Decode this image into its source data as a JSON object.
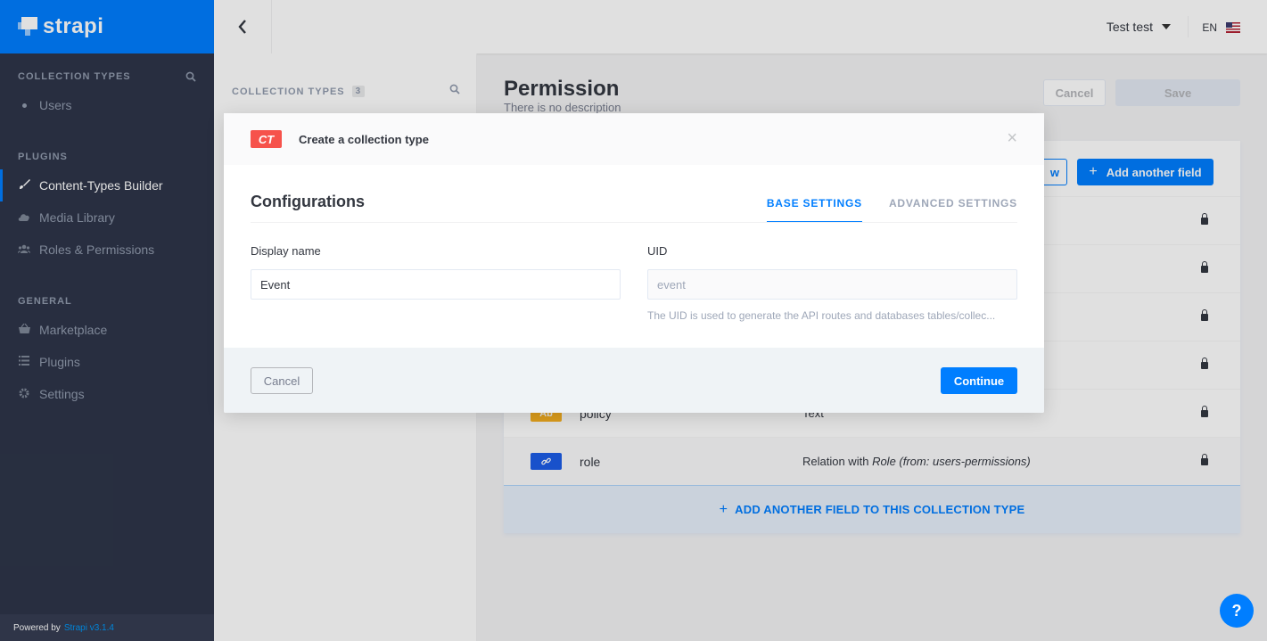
{
  "brand": {
    "name": "strapi"
  },
  "leftnav": {
    "sections": [
      {
        "title": "COLLECTION TYPES",
        "items": [
          {
            "label": "Users"
          }
        ]
      },
      {
        "title": "PLUGINS",
        "items": [
          {
            "label": "Content-Types Builder",
            "icon": "brush-icon"
          },
          {
            "label": "Media Library",
            "icon": "cloud-icon"
          },
          {
            "label": "Roles & Permissions",
            "icon": "users-icon"
          }
        ]
      },
      {
        "title": "GENERAL",
        "items": [
          {
            "label": "Marketplace",
            "icon": "shopping-basket-icon"
          },
          {
            "label": "Plugins",
            "icon": "list-icon"
          },
          {
            "label": "Settings",
            "icon": "gear-icon"
          }
        ]
      }
    ],
    "powered_by": "Powered by",
    "version_link": "Strapi v3.1.4"
  },
  "header": {
    "user": "Test test",
    "lang": "EN"
  },
  "ct_panel": {
    "title": "COLLECTION TYPES",
    "count": "3"
  },
  "main": {
    "title": "Permission",
    "description": "There is no description",
    "cancel_label": "Cancel",
    "save_label": "Save",
    "edit_label": "w",
    "add_field_label": "Add another field",
    "rows": [
      {
        "name": "policy",
        "type": "Text",
        "badge": "Ab",
        "badge_color": "#fab220"
      },
      {
        "name": "role",
        "type_prefix": "Relation with",
        "type_italic": "Role (from: users-permissions)",
        "badge_color": "#1c5de7"
      }
    ],
    "add_footer_label": "ADD ANOTHER FIELD TO THIS COLLECTION TYPE"
  },
  "modal": {
    "badge": "CT",
    "header_title": "Create a collection type",
    "subtitle": "Configurations",
    "tabs": [
      {
        "label": "BASE SETTINGS"
      },
      {
        "label": "ADVANCED SETTINGS"
      }
    ],
    "display_name_label": "Display name",
    "display_name_value": "Event",
    "uid_label": "UID",
    "uid_value": "event",
    "uid_hint": "The UID is used to generate the API routes and databases tables/collec...",
    "cancel_label": "Cancel",
    "continue_label": "Continue"
  },
  "help_label": "?",
  "colors": {
    "accent": "#007eff",
    "nav_bg": "#2e3549",
    "ct_badge": "#f6524b"
  }
}
